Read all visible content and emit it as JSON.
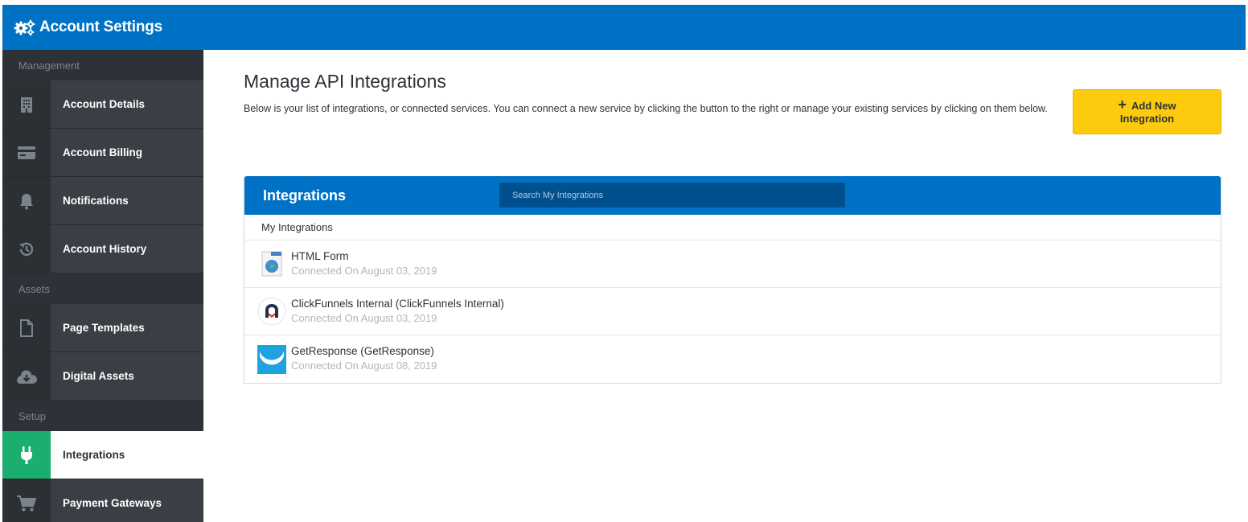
{
  "header": {
    "title": "Account Settings",
    "icon": "gears-icon"
  },
  "sidebar": {
    "sections": [
      {
        "label": "Management"
      },
      {
        "label": "Assets"
      },
      {
        "label": "Setup"
      }
    ],
    "items": [
      {
        "label": "Account Details",
        "icon": "building-icon"
      },
      {
        "label": "Account Billing",
        "icon": "credit-card-icon"
      },
      {
        "label": "Notifications",
        "icon": "bell-icon"
      },
      {
        "label": "Account History",
        "icon": "history-icon"
      },
      {
        "label": "Page Templates",
        "icon": "file-icon"
      },
      {
        "label": "Digital Assets",
        "icon": "cloud-download-icon"
      },
      {
        "label": "Integrations",
        "icon": "plug-icon",
        "active": true
      },
      {
        "label": "Payment Gateways",
        "icon": "cart-icon"
      }
    ]
  },
  "main": {
    "title": "Manage API Integrations",
    "description": "Below is your list of integrations, or connected services. You can connect a new service by clicking the button to the right or manage your existing services by clicking on them below.",
    "add_button": {
      "line1": "Add New",
      "line2": "Integration"
    },
    "panel": {
      "title": "Integrations",
      "search_placeholder": "Search My Integrations",
      "subheader": "My Integrations",
      "rows": [
        {
          "name": "HTML Form",
          "connected": "Connected On August 03, 2019",
          "icon": "html-form-icon"
        },
        {
          "name": "ClickFunnels Internal (ClickFunnels Internal)",
          "connected": "Connected On August 03, 2019",
          "icon": "clickfunnels-icon"
        },
        {
          "name": "GetResponse (GetResponse)",
          "connected": "Connected On August 08, 2019",
          "icon": "getresponse-icon"
        }
      ]
    }
  },
  "colors": {
    "brand_blue": "#0072c6",
    "accent_green": "#1aae6f",
    "button_yellow": "#fdcb0e",
    "sidebar_dark": "#2d3238"
  }
}
